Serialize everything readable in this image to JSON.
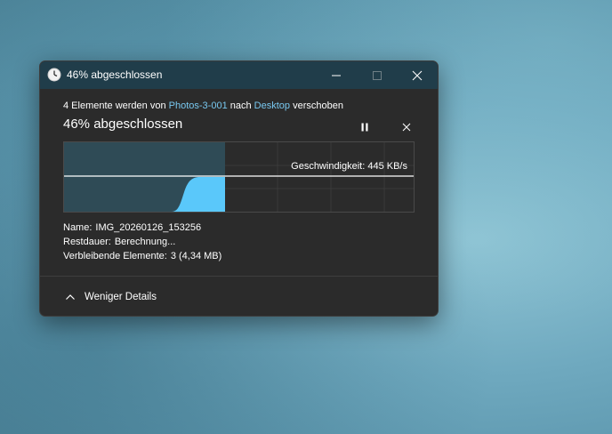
{
  "window": {
    "title": "46% abgeschlossen",
    "title_icon": "clock-icon",
    "controls": [
      "minimize-icon",
      "maximize-icon",
      "close-icon"
    ]
  },
  "operation": {
    "count_text": "4 Elemente werden von",
    "source": "Photos-3-001",
    "middle_text": "nach",
    "destination": "Desktop",
    "end_text": "verschoben",
    "heading": "46% abgeschlossen",
    "progress_fraction": 0.46
  },
  "graph": {
    "speed_label": "Geschwindigkeit: 445 KB/s",
    "fill_color": "#5ac8fa",
    "progress_area_color": "#2f4b56"
  },
  "details": {
    "name_label": "Name:",
    "name_value": "IMG_20260126_153256",
    "time_label": "Restdauer:",
    "time_value": "Berechnung...",
    "items_label": "Verbleibende Elemente:",
    "items_value": "3 (4,34 MB)"
  },
  "footer": {
    "less_details": "Weniger Details"
  },
  "colors": {
    "titlebar": "#203d4a",
    "dialog_bg": "#2b2b2b",
    "link": "#78c8f0",
    "accent": "#5ac8fa"
  }
}
